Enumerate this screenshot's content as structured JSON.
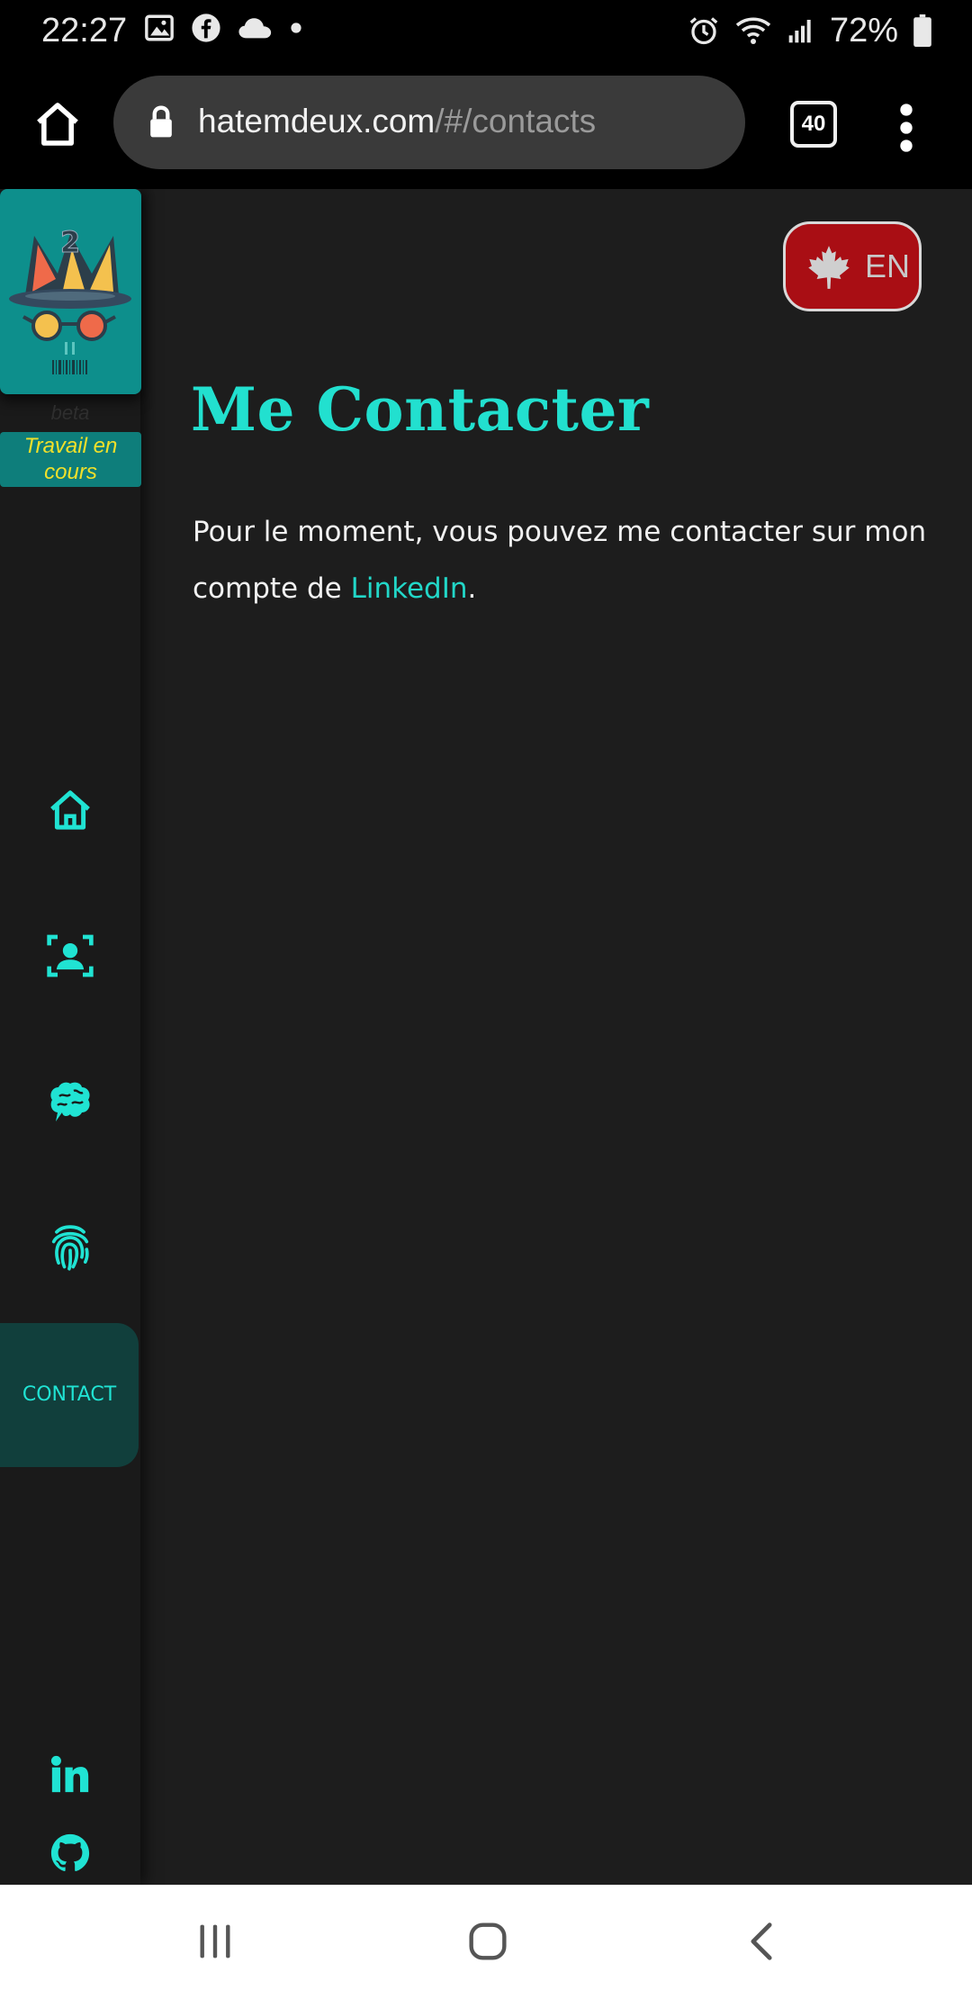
{
  "status_bar": {
    "time": "22:27",
    "battery_percent": "72%",
    "left_icons": [
      "gallery-icon",
      "facebook-icon",
      "cloud-icon",
      "dot-icon"
    ],
    "right_icons": [
      "alarm-icon",
      "wifi-icon",
      "signal-icon",
      "battery-icon"
    ]
  },
  "browser": {
    "url_domain": "hatemdeux.com",
    "url_path": "/#/contacts",
    "tab_count": "40"
  },
  "sidebar": {
    "logo_badge": "2",
    "beta_label": "beta",
    "wip_label": "Travail en cours",
    "nav": [
      {
        "icon": "home-icon"
      },
      {
        "icon": "profile-icon"
      },
      {
        "icon": "brain-icon"
      },
      {
        "icon": "fingerprint-icon"
      },
      {
        "label": "CONTACT",
        "active": true
      }
    ],
    "social": [
      "linkedin-icon",
      "github-icon"
    ]
  },
  "language_button": {
    "label": "EN",
    "icon": "maple-leaf-icon"
  },
  "content": {
    "title": "Me Contacter",
    "text_before_link": "Pour le moment, vous pouvez me contacter sur mon compte de ",
    "link_text": "LinkedIn",
    "text_after_link": "."
  },
  "colors": {
    "accent": "#22e0cf",
    "background": "#1d1d1d",
    "sidebar_bg": "#1a1a1a",
    "logo_bg": "#0d8f8c",
    "wip_text": "#f1e02a",
    "lang_button_bg": "#a90e14"
  }
}
